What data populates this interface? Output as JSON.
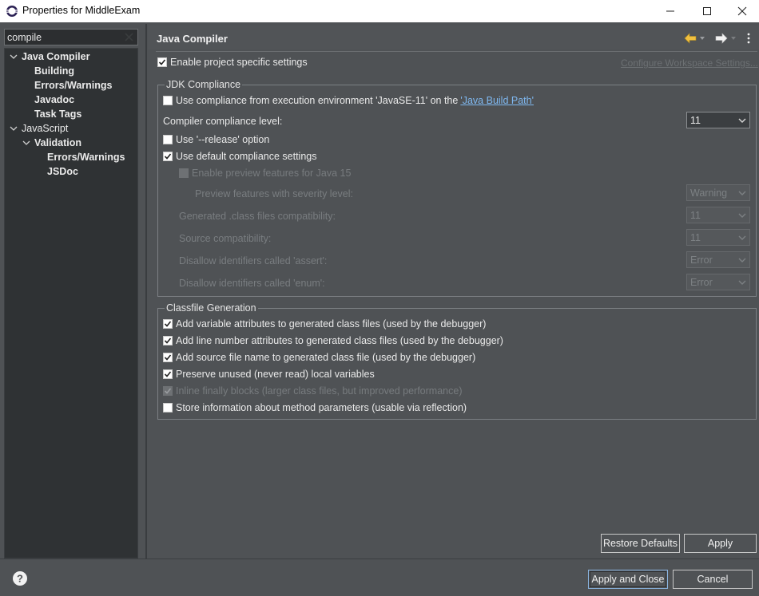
{
  "window": {
    "title": "Properties for MiddleExam"
  },
  "search": {
    "value": "compile"
  },
  "tree": {
    "java_compiler": "Java Compiler",
    "building": "Building",
    "errors_warnings": "Errors/Warnings",
    "javadoc": "Javadoc",
    "task_tags": "Task Tags",
    "javascript": "JavaScript",
    "validation": "Validation",
    "js_errors_warnings": "Errors/Warnings",
    "jsdoc": "JSDoc"
  },
  "page": {
    "title": "Java Compiler",
    "enable_project_specific": "Enable project specific settings",
    "configure_workspace": "Configure Workspace Settings..."
  },
  "jdk": {
    "group_label": "JDK Compliance",
    "use_compliance_prefix": "Use compliance from execution environment 'JavaSE-11' on the",
    "build_path_link": "'Java Build Path'",
    "compliance_level_label": "Compiler compliance level:",
    "compliance_level_value": "11",
    "use_release": "Use '--release' option",
    "use_default": "Use default compliance settings",
    "enable_preview": "Enable preview features for Java 15",
    "preview_severity_label": "Preview features with severity level:",
    "preview_severity_value": "Warning",
    "generated_class_label": "Generated .class files compatibility:",
    "generated_class_value": "11",
    "source_compat_label": "Source compatibility:",
    "source_compat_value": "11",
    "disallow_assert_label": "Disallow identifiers called 'assert':",
    "disallow_assert_value": "Error",
    "disallow_enum_label": "Disallow identifiers called 'enum':",
    "disallow_enum_value": "Error"
  },
  "classfile": {
    "group_label": "Classfile Generation",
    "variable_attrs": "Add variable attributes to generated class files (used by the debugger)",
    "line_number_attrs": "Add line number attributes to generated class files (used by the debugger)",
    "source_file_name": "Add source file name to generated class file (used by the debugger)",
    "preserve_unused": "Preserve unused (never read) local variables",
    "inline_finally": "Inline finally blocks (larger class files, but improved performance)",
    "store_method_params": "Store information about method parameters (usable via reflection)"
  },
  "buttons": {
    "restore_defaults": "Restore Defaults",
    "apply": "Apply",
    "apply_and_close": "Apply and Close",
    "cancel": "Cancel"
  },
  "icons": {
    "back": "back-arrow-icon",
    "forward": "forward-arrow-icon",
    "menu": "view-menu-icon",
    "help": "help-icon"
  },
  "colors": {
    "background": "#4f5255",
    "tree_background": "#2f3234",
    "link": "#7fb8f0",
    "back_arrow": "#f0c040"
  }
}
